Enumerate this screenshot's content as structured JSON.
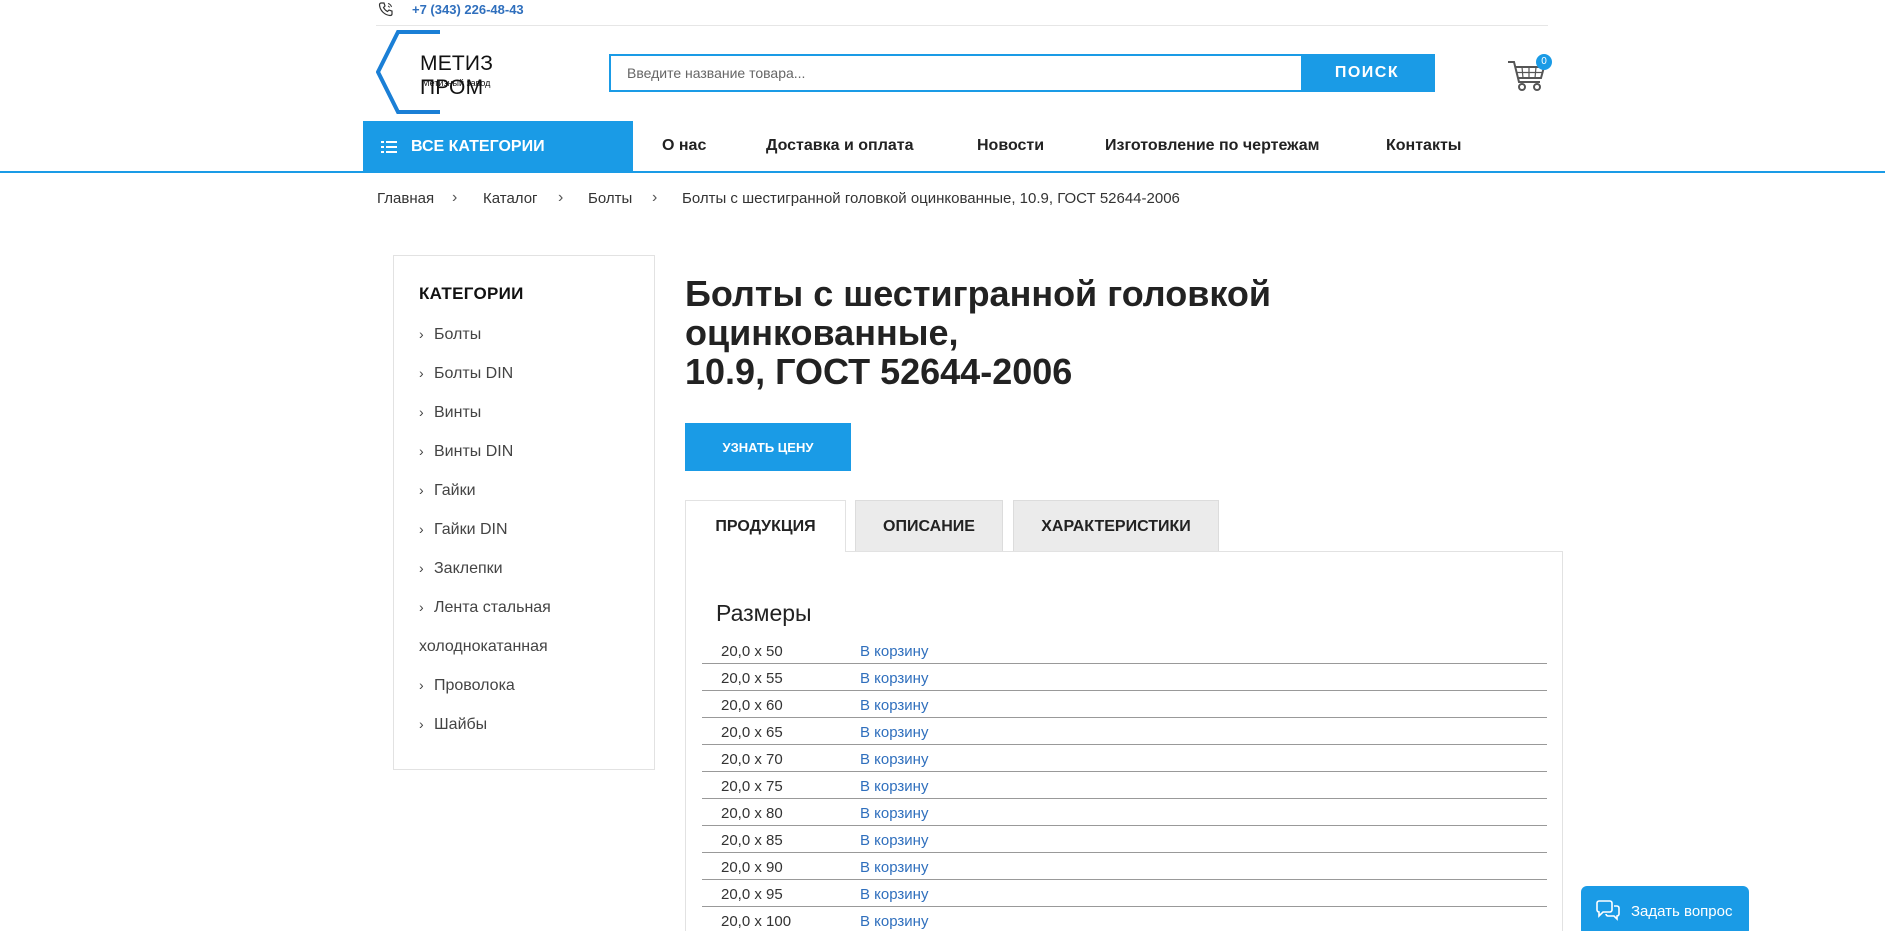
{
  "topbar": {
    "phone": "+7 (343) 226-48-43"
  },
  "logo": {
    "name": "МЕТИЗ ПРОМ",
    "subtitle": "Метизный завод"
  },
  "search": {
    "placeholder": "Введите название товара...",
    "button_label": "ПОИСК"
  },
  "cart": {
    "count": "0"
  },
  "nav": {
    "all_categories": "ВСЕ КАТЕГОРИИ",
    "items": [
      "О нас",
      "Доставка и оплата",
      "Новости",
      "Изготовление по чертежам",
      "Контакты"
    ]
  },
  "breadcrumb": {
    "items": [
      "Главная",
      "Каталог",
      "Болты",
      "Болты с шестигранной головкой оцинкованные, 10.9, ГОСТ 52644-2006"
    ],
    "separator": "›"
  },
  "sidebar": {
    "title": "КАТЕГОРИИ",
    "items": [
      "Болты",
      "Болты DIN",
      "Винты",
      "Винты DIN",
      "Гайки",
      "Гайки DIN",
      "Заклепки",
      "Лента стальная",
      "Проволока",
      "Шайбы"
    ],
    "wrap_text": "холоднокатанная",
    "chevron": "›"
  },
  "product": {
    "title_line1": "Болты с шестигранной головкой оцинкованные,",
    "title_line2": "10.9, ГОСТ 52644-2006",
    "price_button": "УЗНАТЬ ЦЕНУ"
  },
  "tabs": [
    "ПРОДУКЦИЯ",
    "ОПИСАНИЕ",
    "ХАРАКТЕРИСТИКИ"
  ],
  "sizes": {
    "title": "Размеры",
    "cart_label": "В корзину",
    "rows": [
      "20,0 x 50",
      "20,0 x 55",
      "20,0 x 60",
      "20,0 x 65",
      "20,0 x 70",
      "20,0 x 75",
      "20,0 x 80",
      "20,0 x 85",
      "20,0 x 90",
      "20,0 x 95",
      "20,0 x 100"
    ]
  },
  "ask": {
    "label": "Задать вопрос"
  },
  "colors": {
    "accent": "#1a9be6",
    "link": "#2f6fbd"
  }
}
